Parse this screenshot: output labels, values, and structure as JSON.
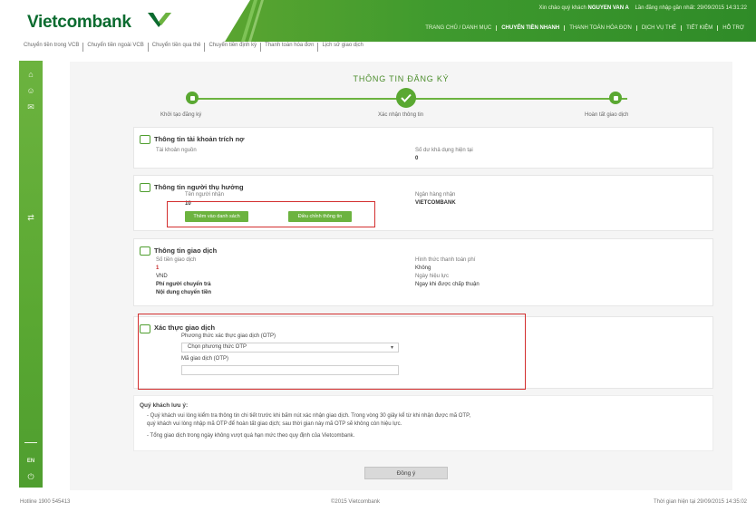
{
  "brand": {
    "name": "Vietcombank",
    "color": "#0b6b2f",
    "accent": "#5aa832"
  },
  "header": {
    "user_prefix": "Xin chào quý khách",
    "user_name": "NGUYEN VAN A",
    "last_login": "Lần đăng nhập gần nhất: 29/09/2015 14:31:22",
    "nav": [
      {
        "label": "TRANG CHỦ / DANH MỤC",
        "active": false
      },
      {
        "label": "CHUYỂN TIỀN NHANH",
        "active": true
      },
      {
        "label": "THANH TOÁN HÓA ĐƠN",
        "active": false
      },
      {
        "label": "DỊCH VỤ THẺ",
        "active": false
      },
      {
        "label": "TIẾT KIỆM",
        "active": false
      },
      {
        "label": "HỖ TRỢ",
        "active": false
      }
    ]
  },
  "sub_nav": [
    "Chuyển tiền trong VCB",
    "Chuyển tiền ngoài VCB",
    "Chuyển tiền qua thẻ",
    "Chuyển tiền định kỳ",
    "Thanh toán hóa đơn",
    "Lịch sử giao dịch"
  ],
  "sidebar": {
    "icons": [
      "home-icon",
      "user-icon",
      "wallet-icon",
      "chart-icon",
      "language-icon",
      "power-icon"
    ],
    "lang": "EN"
  },
  "page": {
    "title": "THÔNG TIN ĐĂNG KÝ",
    "steps": [
      {
        "label": "Khởi tạo đăng ký",
        "state": "done"
      },
      {
        "label": "Xác nhận thông tin",
        "state": "current"
      },
      {
        "label": "Hoàn tất giao dịch",
        "state": "pending"
      }
    ]
  },
  "account_section": {
    "title": "Thông tin tài khoản trích nợ",
    "label_1": "Tài khoản nguồn",
    "label_2": "Số dư khả dụng hiện tại",
    "value_2": "0"
  },
  "beneficiary_section": {
    "title": "Thông tin người thụ hưởng",
    "label_1": "Tên người nhận",
    "value_1": "10",
    "label_2": "Ngân hàng nhận",
    "value_2": "VIETCOMBANK",
    "btn_add": "Thêm vào danh sách",
    "btn_edit": "Điều chỉnh thông tin"
  },
  "transaction_section": {
    "title": "Thông tin giao dịch",
    "label_amount": "Số tiền giao dịch",
    "value_amount": "1",
    "label_currency": "VND",
    "label_fee": "Phí người chuyển trả",
    "label_content": "Nội dung chuyển tiền",
    "label_fee_type": "Hình thức thanh toán phí",
    "value_fee_type": "Không",
    "label_method": "Ngày hiệu lực",
    "value_method": "Ngay khi được chấp thuận"
  },
  "auth_section": {
    "title": "Xác thực giao dịch",
    "method_label": "Phương thức xác thực giao dịch (OTP)",
    "method_value": "Chọn phương thức OTP",
    "otp_label": "Mã giao dịch (OTP)",
    "otp_placeholder": ""
  },
  "notes": {
    "title": "Quý khách lưu ý:",
    "line_1": "- Quý khách vui lòng kiểm tra thông tin chi tiết trước khi bấm nút xác nhận giao dịch. Trong vòng 30 giây kể từ khi nhận được mã OTP,",
    "line_2": "quý khách vui lòng nhập mã OTP để hoàn tất giao dịch; sau thời gian này mã OTP sẽ không còn hiệu lực.",
    "line_3": "- Tổng giao dịch trong ngày không vượt quá hạn mức theo quy định của Vietcombank."
  },
  "confirm_label": "Đồng ý",
  "footer": {
    "left": "Hotline 1900 545413",
    "center": "©2015 Vietcombank",
    "right": "Thời gian hiện tại 29/09/2015 14:35:02"
  }
}
